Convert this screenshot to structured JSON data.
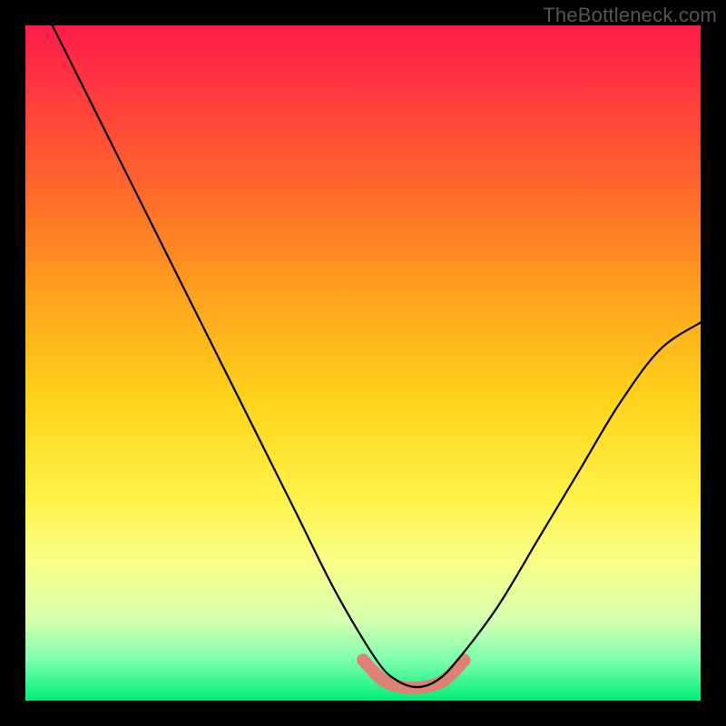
{
  "watermark": "TheBottleneck.com",
  "chart_data": {
    "type": "line",
    "title": "",
    "xlabel": "",
    "ylabel": "",
    "xlim": [
      0,
      1
    ],
    "ylim": [
      0,
      1
    ],
    "grid": false,
    "legend": null,
    "background": "vertical-gradient red→orange→yellow→green",
    "series": [
      {
        "name": "bottleneck-curve",
        "stroke": "#000000",
        "x": [
          0.04,
          0.1,
          0.16,
          0.22,
          0.28,
          0.34,
          0.4,
          0.46,
          0.52,
          0.55,
          0.58,
          0.61,
          0.64,
          0.7,
          0.76,
          0.82,
          0.88,
          0.94,
          1.0
        ],
        "values": [
          1.0,
          0.88,
          0.76,
          0.64,
          0.52,
          0.4,
          0.28,
          0.16,
          0.06,
          0.03,
          0.02,
          0.03,
          0.06,
          0.14,
          0.24,
          0.34,
          0.44,
          0.52,
          0.56
        ]
      },
      {
        "name": "optimal-highlight",
        "stroke": "#e77a72",
        "x": [
          0.5,
          0.53,
          0.56,
          0.59,
          0.62,
          0.65
        ],
        "values": [
          0.06,
          0.03,
          0.02,
          0.02,
          0.03,
          0.06
        ]
      }
    ],
    "annotations": []
  }
}
